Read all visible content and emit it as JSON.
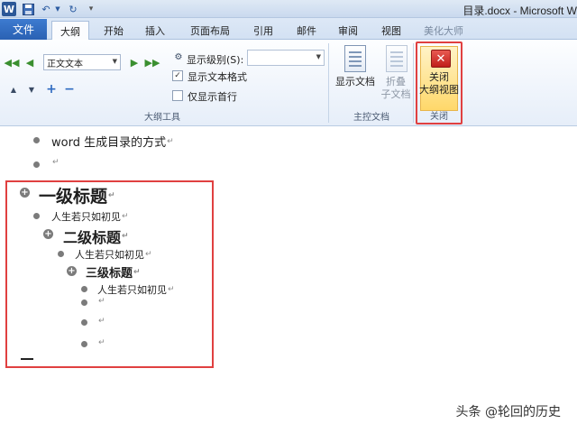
{
  "titlebar": {
    "logo_letter": "W",
    "title": "目录.docx - Microsoft W"
  },
  "tabs": {
    "file": "文件",
    "items": [
      "大纲",
      "开始",
      "插入",
      "页面布局",
      "引用",
      "邮件",
      "审阅",
      "视图",
      "美化大师"
    ],
    "active": "大纲"
  },
  "ribbon": {
    "outline_tools": {
      "level_value": "正文文本",
      "show_level_label": "显示级别(S):",
      "show_text_format": "显示文本格式",
      "show_first_line": "仅显示首行",
      "show_text_format_checked": true,
      "show_first_line_checked": false,
      "group_label": "大纲工具"
    },
    "master_document": {
      "show_document": "显示文档",
      "collapse_line1": "折叠",
      "collapse_line2": "子文档",
      "group_label": "主控文档"
    },
    "close": {
      "label_line1": "关闭",
      "label_line2": "大纲视图",
      "group_label": "关闭"
    }
  },
  "document": {
    "line1": "word 生成目录的方式",
    "heading1": "一级标题",
    "body1": "人生若只如初见",
    "heading2": "二级标题",
    "body2": "人生若只如初见",
    "heading3": "三级标题",
    "body3": "人生若只如初见",
    "para_mark": "↵"
  },
  "watermark": "头条 @轮回的历史",
  "colors": {
    "accent": "#2b5797",
    "highlight_border": "#e04040"
  }
}
